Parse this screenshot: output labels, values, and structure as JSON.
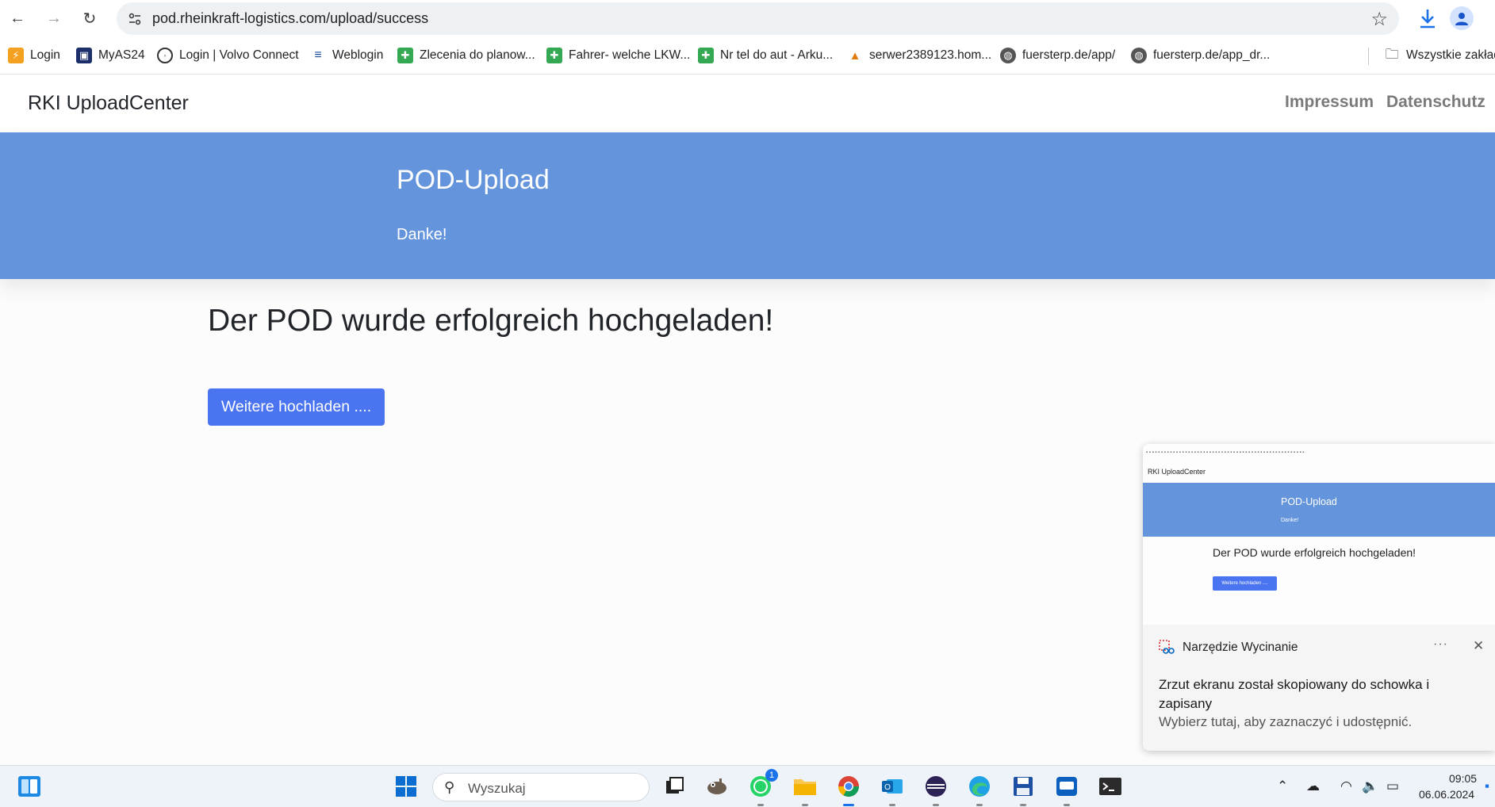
{
  "browser": {
    "url": "pod.rheinkraft-logistics.com/upload/success",
    "bookmarks": [
      {
        "label": "Login",
        "icon": "login-favicon",
        "color": "#f4a020"
      },
      {
        "label": "MyAS24",
        "icon": "myas24-favicon",
        "color": "#1c2f6a"
      },
      {
        "label": "Login | Volvo Connect",
        "icon": "volvo-favicon",
        "color": "#333333"
      },
      {
        "label": "Weblogin",
        "icon": "weblogin-favicon",
        "color": "#1f4e9e"
      },
      {
        "label": "Zlecenia do planow...",
        "icon": "sheets-favicon",
        "color": "#34a853"
      },
      {
        "label": "Fahrer- welche LKW...",
        "icon": "sheets-favicon",
        "color": "#34a853"
      },
      {
        "label": "Nr tel do aut - Arku...",
        "icon": "sheets-favicon",
        "color": "#34a853"
      },
      {
        "label": "serwer2389123.hom...",
        "icon": "pma-favicon",
        "color": "#e07b10"
      },
      {
        "label": "fuersterp.de/app/",
        "icon": "globe-favicon",
        "color": "#555555"
      },
      {
        "label": "fuersterp.de/app_dr...",
        "icon": "globe-favicon",
        "color": "#555555"
      }
    ],
    "all_bookmarks_label": "Wszystkie zakładki"
  },
  "page": {
    "brand": "RKI UploadCenter",
    "nav": {
      "impressum": "Impressum",
      "datenschutz": "Datenschutz"
    },
    "hero_title": "POD-Upload",
    "hero_subtitle": "Danke!",
    "success_heading": "Der POD wurde erfolgreich hochgeladen!",
    "upload_more_button": "Weitere hochladen ....",
    "accent_color": "#6495dc",
    "button_color": "#4a74f0"
  },
  "notification": {
    "app_name": "Narzędzie Wycinanie",
    "more_label": "···",
    "close_label": "✕",
    "body": "Zrzut ekranu został skopiowany do schowka i zapisany",
    "hint": "Wybierz tutaj, aby zaznaczyć i udostępnić.",
    "preview": {
      "brand": "RKI UploadCenter",
      "hero_title": "POD-Upload",
      "hero_subtitle": "Danke!",
      "heading": "Der POD wurde erfolgreich hochgeladen!",
      "button": "Weitere hochladen ...."
    }
  },
  "taskbar": {
    "search_placeholder": "Wyszukaj",
    "whatsapp_badge": "1",
    "time": "09:05",
    "date": "06.06.2024"
  }
}
